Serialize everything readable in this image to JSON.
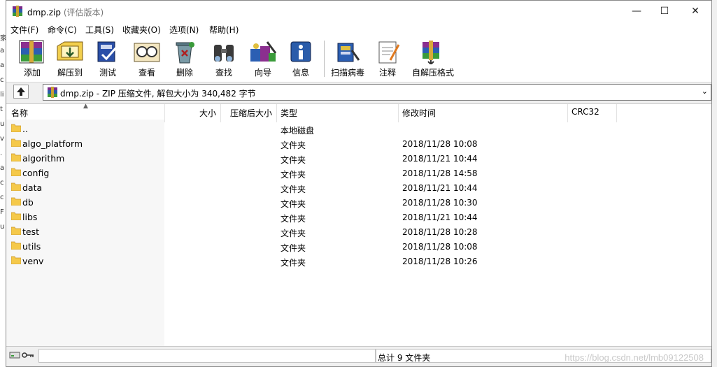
{
  "window": {
    "title": "dmp.zip",
    "title_suffix": "(评估版本)",
    "controls": {
      "minimize": "—",
      "maximize": "☐",
      "close": "✕"
    }
  },
  "menu": [
    "文件(F)",
    "命令(C)",
    "工具(S)",
    "收藏夹(O)",
    "选项(N)",
    "帮助(H)"
  ],
  "toolbar": [
    {
      "label": "添加",
      "icon": "add-archive-icon"
    },
    {
      "label": "解压到",
      "icon": "extract-to-icon"
    },
    {
      "label": "测试",
      "icon": "test-icon"
    },
    {
      "label": "查看",
      "icon": "view-icon"
    },
    {
      "label": "删除",
      "icon": "delete-icon"
    },
    {
      "label": "查找",
      "icon": "find-icon"
    },
    {
      "label": "向导",
      "icon": "wizard-icon"
    },
    {
      "label": "信息",
      "icon": "info-icon"
    },
    {
      "label": "扫描病毒",
      "icon": "virus-scan-icon"
    },
    {
      "label": "注释",
      "icon": "comment-icon"
    },
    {
      "label": "自解压格式",
      "icon": "sfx-icon"
    }
  ],
  "address": "dmp.zip - ZIP 压缩文件, 解包大小为 340,482 字节",
  "columns": {
    "name": "名称",
    "size": "大小",
    "packed": "压缩后大小",
    "type": "类型",
    "modified": "修改时间",
    "crc": "CRC32"
  },
  "files": [
    {
      "name": "..",
      "type": "本地磁盘",
      "modified": ""
    },
    {
      "name": "algo_platform",
      "type": "文件夹",
      "modified": "2018/11/28 10:08"
    },
    {
      "name": "algorithm",
      "type": "文件夹",
      "modified": "2018/11/21 10:44"
    },
    {
      "name": "config",
      "type": "文件夹",
      "modified": "2018/11/28 14:58"
    },
    {
      "name": "data",
      "type": "文件夹",
      "modified": "2018/11/21 10:44"
    },
    {
      "name": "db",
      "type": "文件夹",
      "modified": "2018/11/28 10:30"
    },
    {
      "name": "libs",
      "type": "文件夹",
      "modified": "2018/11/21 10:44"
    },
    {
      "name": "test",
      "type": "文件夹",
      "modified": "2018/11/28 10:28"
    },
    {
      "name": "utils",
      "type": "文件夹",
      "modified": "2018/11/28 10:08"
    },
    {
      "name": "venv",
      "type": "文件夹",
      "modified": "2018/11/28 10:26"
    }
  ],
  "status": {
    "total": "总计 9 文件夹",
    "watermark": "https://blog.csdn.net/lmb09122508"
  },
  "left_strip": [
    "家",
    "a",
    "a",
    "c",
    "li",
    "t",
    "u",
    "v",
    ".",
    "a",
    "c",
    "c",
    "F",
    "u"
  ]
}
